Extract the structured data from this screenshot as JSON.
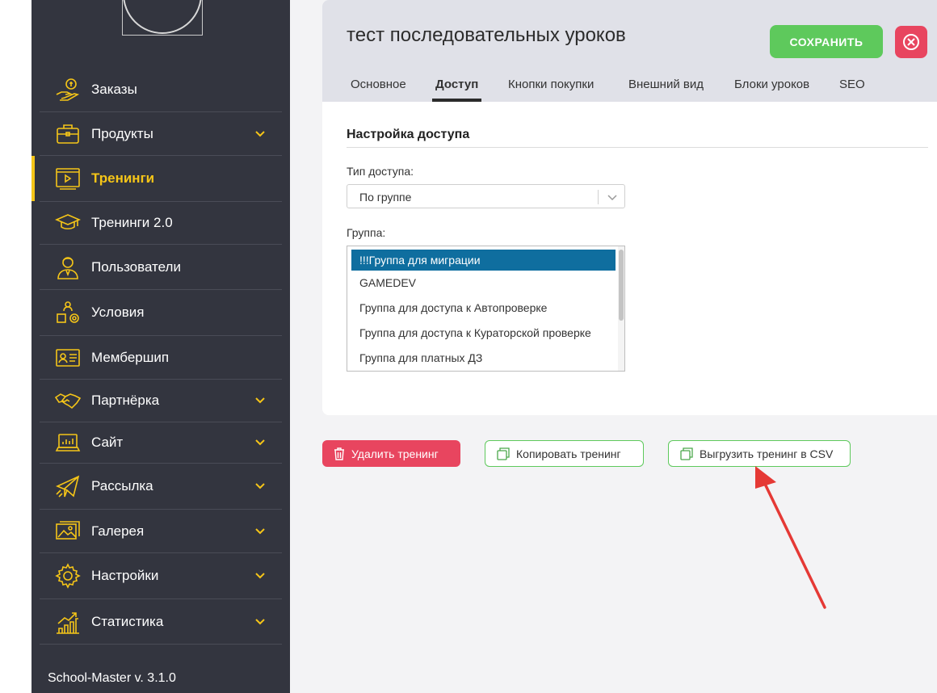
{
  "sidebar": {
    "items": [
      {
        "label": "Заказы",
        "icon": "money-hand-icon",
        "has_chevron": false,
        "active": false
      },
      {
        "label": "Продукты",
        "icon": "briefcase-icon",
        "has_chevron": true,
        "active": false
      },
      {
        "label": "Тренинги",
        "icon": "video-player-icon",
        "has_chevron": false,
        "active": true
      },
      {
        "label": "Тренинги 2.0",
        "icon": "graduation-cap-icon",
        "has_chevron": false,
        "active": false
      },
      {
        "label": "Пользователи",
        "icon": "user-icon",
        "has_chevron": false,
        "active": false
      },
      {
        "label": "Условия",
        "icon": "conditions-icon",
        "has_chevron": false,
        "active": false
      },
      {
        "label": "Мембершип",
        "icon": "id-card-icon",
        "has_chevron": false,
        "active": false
      },
      {
        "label": "Партнёрка",
        "icon": "handshake-icon",
        "has_chevron": true,
        "active": false
      },
      {
        "label": "Сайт",
        "icon": "laptop-icon",
        "has_chevron": true,
        "active": false
      },
      {
        "label": "Рассылка",
        "icon": "paper-plane-icon",
        "has_chevron": true,
        "active": false
      },
      {
        "label": "Галерея",
        "icon": "image-gallery-icon",
        "has_chevron": true,
        "active": false
      },
      {
        "label": "Настройки",
        "icon": "gear-icon",
        "has_chevron": true,
        "active": false
      },
      {
        "label": "Статистика",
        "icon": "bar-chart-icon",
        "has_chevron": true,
        "active": false
      }
    ],
    "version": "School-Master v. 3.1.0"
  },
  "header": {
    "title": "тест последовательных уроков",
    "save_label": "СОХРАНИТЬ",
    "tabs": [
      {
        "label": "Основное",
        "active": false
      },
      {
        "label": "Доступ",
        "active": true
      },
      {
        "label": "Кнопки покупки",
        "active": false
      },
      {
        "label": "Внешний вид",
        "active": false
      },
      {
        "label": "Блоки уроков",
        "active": false
      },
      {
        "label": "SEO",
        "active": false
      }
    ]
  },
  "access": {
    "section_title": "Настройка доступа",
    "type_label": "Тип доступа:",
    "type_value": "По группе",
    "group_label": "Группа:",
    "groups": [
      {
        "label": "!!!Группа для миграции",
        "selected": true
      },
      {
        "label": "GAMEDEV",
        "selected": false
      },
      {
        "label": "Группа для доступа к Автопроверке",
        "selected": false
      },
      {
        "label": "Группа для доступа к Кураторской проверке",
        "selected": false
      },
      {
        "label": "Группа для платных ДЗ",
        "selected": false
      }
    ]
  },
  "actions": {
    "delete_label": "Удалить тренинг",
    "copy_label": "Копировать тренинг",
    "export_label": "Выгрузить тренинг в CSV"
  },
  "colors": {
    "sidebar_bg": "#33353f",
    "accent_yellow": "#f5c518",
    "save_green": "#5ec95c",
    "danger_red": "#e8455f",
    "selected_blue": "#0f6e9f",
    "annotation_arrow": "#e53935"
  }
}
